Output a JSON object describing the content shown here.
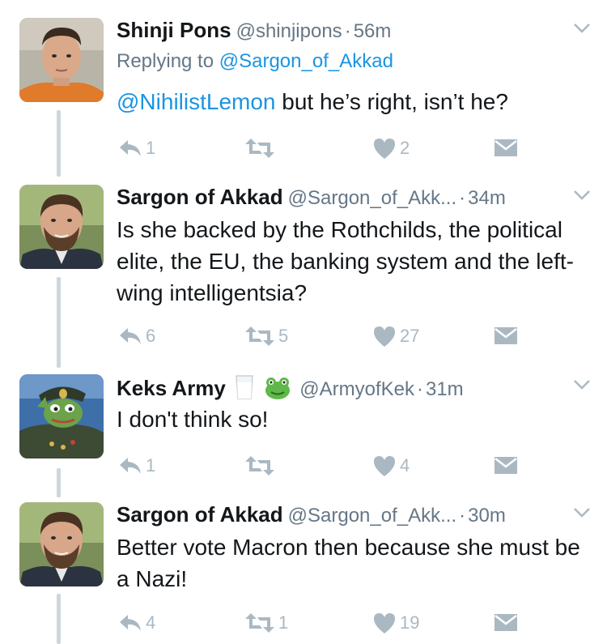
{
  "tweets": [
    {
      "name": "Shinji Pons",
      "handle": "@shinjipons",
      "time": "56m",
      "reply_prefix": "Replying to",
      "reply_target": "@Sargon_of_Akkad",
      "mention": "@NihilistLemon",
      "text": " but he’s right, isn’t he?",
      "replies": "1",
      "retweets": "",
      "likes": "2"
    },
    {
      "name": "Sargon of Akkad",
      "handle": "@Sargon_of_Akk...",
      "time": "34m",
      "text": "Is she backed by the Rothchilds, the political elite, the EU, the banking system and the left-wing intelligentsia?",
      "replies": "6",
      "retweets": "5",
      "likes": "27"
    },
    {
      "name": "Keks Army",
      "handle": "@ArmyofKek",
      "time": "31m",
      "name_emoji": [
        "milk-glass-emoji",
        "frog-emoji"
      ],
      "text": "I don't think so!",
      "replies": "1",
      "retweets": "",
      "likes": "4"
    },
    {
      "name": "Sargon of Akkad",
      "handle": "@Sargon_of_Akk...",
      "time": "30m",
      "text": "Better vote Macron then because she must be a Nazi!",
      "replies": "4",
      "retweets": "1",
      "likes": "19"
    }
  ],
  "separator": "·",
  "colors": {
    "name": "#14171a",
    "meta": "#657786",
    "link": "#1b95e0",
    "icon": "#aab8c2",
    "thread_line": "#ccd6dd"
  },
  "icons": [
    "reply-icon",
    "retweet-icon",
    "like-icon",
    "direct-message-icon",
    "chevron-down-icon"
  ]
}
